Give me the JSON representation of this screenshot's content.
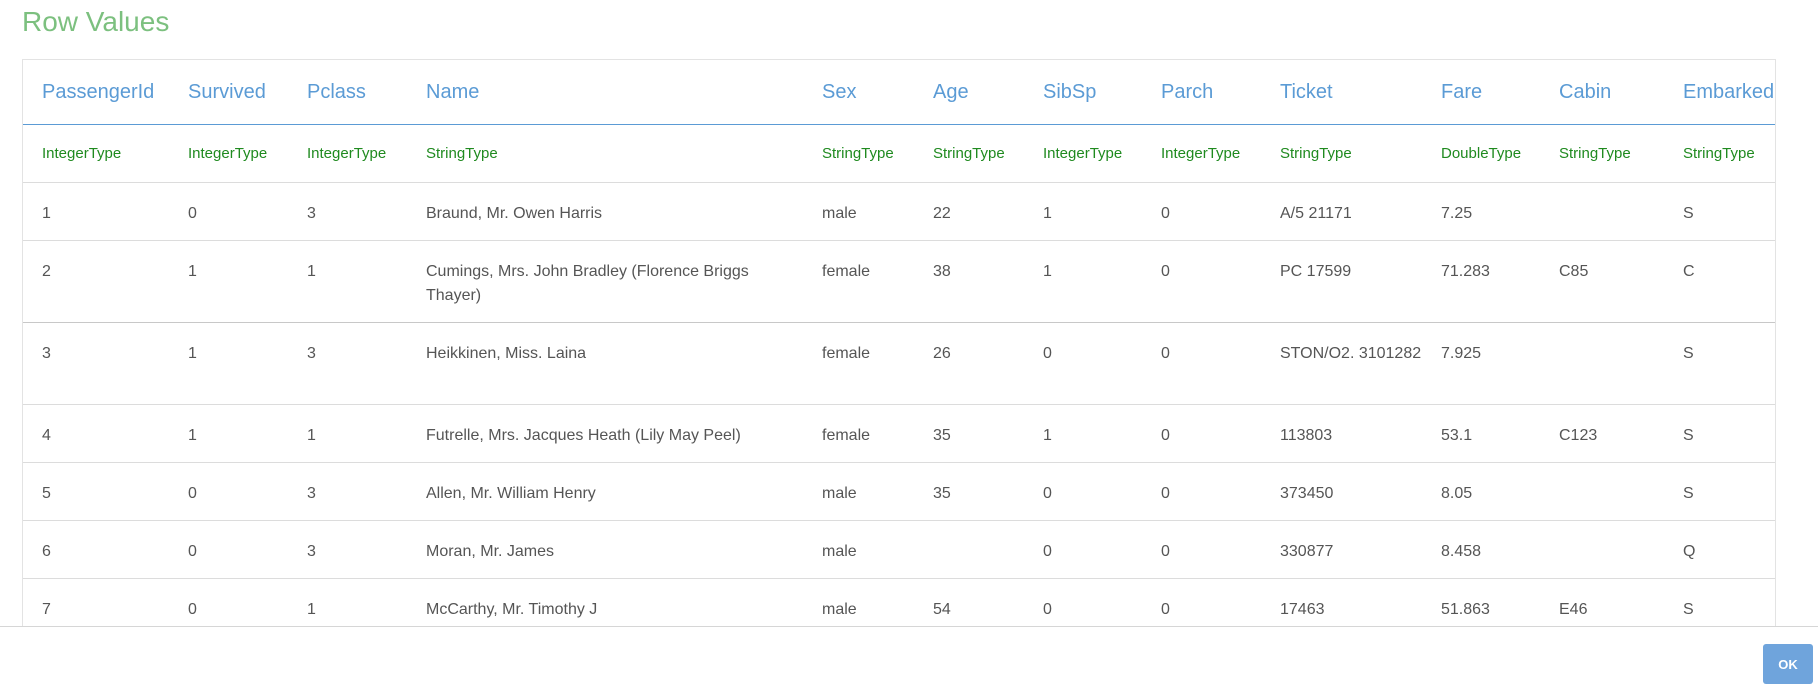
{
  "dialog": {
    "title": "Row Values",
    "ok_label": "OK"
  },
  "table": {
    "columns": [
      "PassengerId",
      "Survived",
      "Pclass",
      "Name",
      "Sex",
      "Age",
      "SibSp",
      "Parch",
      "Ticket",
      "Fare",
      "Cabin",
      "Embarked"
    ],
    "types": [
      "IntegerType",
      "IntegerType",
      "IntegerType",
      "StringType",
      "StringType",
      "StringType",
      "IntegerType",
      "IntegerType",
      "StringType",
      "DoubleType",
      "StringType",
      "StringType"
    ],
    "rows": [
      [
        "1",
        "0",
        "3",
        "Braund, Mr. Owen Harris",
        "male",
        "22",
        "1",
        "0",
        "A/5 21171",
        "7.25",
        "",
        "S"
      ],
      [
        "2",
        "1",
        "1",
        "Cumings, Mrs. John Bradley (Florence Briggs Thayer)",
        "female",
        "38",
        "1",
        "0",
        "PC 17599",
        "71.283",
        "C85",
        "C"
      ],
      [
        "3",
        "1",
        "3",
        "Heikkinen, Miss. Laina",
        "female",
        "26",
        "0",
        "0",
        "STON/O2. 3101282",
        "7.925",
        "",
        "S"
      ],
      [
        "4",
        "1",
        "1",
        "Futrelle, Mrs. Jacques Heath (Lily May Peel)",
        "female",
        "35",
        "1",
        "0",
        "113803",
        "53.1",
        "C123",
        "S"
      ],
      [
        "5",
        "0",
        "3",
        "Allen, Mr. William Henry",
        "male",
        "35",
        "0",
        "0",
        "373450",
        "8.05",
        "",
        "S"
      ],
      [
        "6",
        "0",
        "3",
        "Moran, Mr. James",
        "male",
        "",
        "0",
        "0",
        "330877",
        "8.458",
        "",
        "Q"
      ],
      [
        "7",
        "0",
        "1",
        "McCarthy, Mr. Timothy J",
        "male",
        "54",
        "0",
        "0",
        "17463",
        "51.863",
        "E46",
        "S"
      ]
    ]
  },
  "colors": {
    "title": "#7cc07f",
    "column_header": "#5b9bd5",
    "type_label": "#1f8a1f",
    "cell_text": "#555555",
    "ok_button": "#6fa4dc"
  }
}
